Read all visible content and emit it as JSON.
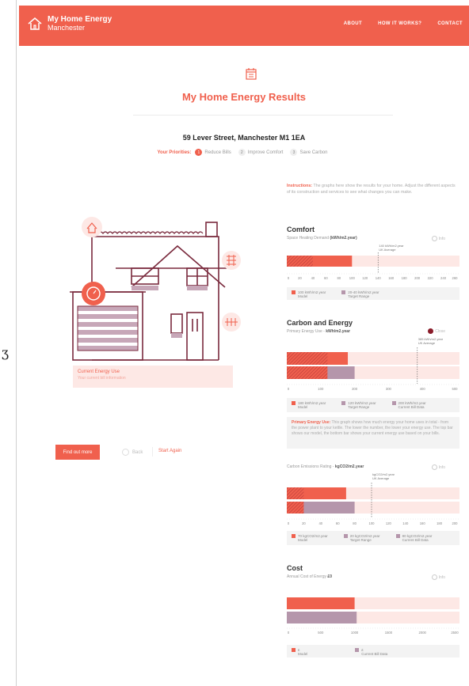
{
  "brand": {
    "line1": "My Home Energy",
    "line2": "Manchester"
  },
  "nav": [
    "ABOUT",
    "HOW IT WORKS?",
    "CONTACT"
  ],
  "page_title": "My Home Energy Results",
  "address": "59 Lever Street, Manchester M1 1EA",
  "priorities": {
    "label": "Your Priorities:",
    "steps": [
      {
        "num": "1",
        "label": "Reduce Bills"
      },
      {
        "num": "2",
        "label": "Improve Comfort"
      },
      {
        "num": "3",
        "label": "Save Carbon"
      }
    ]
  },
  "energy_card": {
    "title": "Current Energy Use",
    "subtitle": "Your current bill information"
  },
  "actions": {
    "find_out_more": "Find out more",
    "back": "Back",
    "start_again": "Start Again"
  },
  "instructions": {
    "lead": "Instructions:",
    "text": " The graphs here show the results for your home. Adjust the different aspects of its construction and services to see what changes you can make."
  },
  "colors": {
    "accent": "#f0604d",
    "model": "#f0604d",
    "target": "#b596ab",
    "dark": "#8a1c2a",
    "track": "#fde8e5"
  },
  "comfort": {
    "title": "Comfort",
    "sub_prefix": "Space Heating Demand",
    "sub_unit": "(kWh/m2.year)",
    "info": "Info",
    "avg_label_1": "140 kWh/m2.year",
    "avg_label_2": "UK Average",
    "legend": [
      {
        "value": "100 kWh/m2.year",
        "label": "Model"
      },
      {
        "value": "20-40 kWh/m2.year",
        "label": "Target Range"
      }
    ]
  },
  "carbon": {
    "title": "Carbon and Energy",
    "sub_prefix": "Primary Energy Use -",
    "sub_unit": "kWh/m2.year",
    "close": "Close",
    "avg_label_1": "385 kWh/m2.year",
    "avg_label_2": "UK Average",
    "legend": [
      {
        "value": "180 kWh/m2.year",
        "label": "Model"
      },
      {
        "value": "120 kWh/m2.year",
        "label": "Target Range"
      },
      {
        "value": "200 kWh/m2.year",
        "label": "Current Bill Data"
      }
    ],
    "desc_lead": "Primary Energy Use:",
    "desc_text": " This graph shows how much energy your home uses in total - from the power plant to your kettle. The lower the number, the lower your energy use. The top bar shows our model, the bottom bar shows your current energy use based on your bills."
  },
  "emissions": {
    "sub_prefix": "Carbon Emissions Rating -",
    "sub_unit": "kgCO2/m2.year",
    "info": "Info",
    "avg_label_1": "kgCO2/m2.year",
    "avg_label_2": "UK Average",
    "legend": [
      {
        "value": "70 kgCO2/m2.year",
        "label": "Model"
      },
      {
        "value": "20 kgCO2/m2.year",
        "label": "Target Range"
      },
      {
        "value": "80 kgCO2/m2.year",
        "label": "Current Bill Data"
      }
    ]
  },
  "cost": {
    "title": "Cost",
    "sub_prefix": "Annual Cost of Energy",
    "sub_unit": "£0",
    "info": "Info",
    "legend": [
      {
        "value": "£",
        "label": "Model"
      },
      {
        "value": "£",
        "label": "Current Bill Data"
      }
    ]
  },
  "chart_data": [
    {
      "type": "bar",
      "title": "Comfort",
      "ylabel": "Space Heating Demand (kWh/m2.year)",
      "xlim": [
        0,
        260
      ],
      "ticks": [
        0,
        20,
        40,
        60,
        80,
        100,
        120,
        140,
        160,
        180,
        200,
        220,
        240,
        260
      ],
      "reference": {
        "name": "UK Average",
        "value": 140
      },
      "series": [
        {
          "name": "Model",
          "values": [
            100
          ]
        },
        {
          "name": "Target Range",
          "range": [
            20,
            40
          ]
        }
      ]
    },
    {
      "type": "bar",
      "title": "Carbon and Energy",
      "ylabel": "Primary Energy Use - kWh/m2.year",
      "xlim": [
        0,
        500
      ],
      "ticks": [
        0,
        100,
        200,
        300,
        400,
        500
      ],
      "reference": {
        "name": "UK Average",
        "value": 385
      },
      "series": [
        {
          "name": "Model",
          "values": [
            180
          ]
        },
        {
          "name": "Target Range",
          "values": [
            120
          ]
        },
        {
          "name": "Current Bill Data",
          "values": [
            200
          ]
        }
      ]
    },
    {
      "type": "bar",
      "title": "Carbon Emissions Rating",
      "ylabel": "kgCO2/m2.year",
      "xlim": [
        0,
        200
      ],
      "ticks": [
        0,
        20,
        40,
        60,
        80,
        100,
        120,
        140,
        160,
        180,
        200
      ],
      "reference": {
        "name": "UK Average",
        "value": 100
      },
      "series": [
        {
          "name": "Model",
          "values": [
            70
          ]
        },
        {
          "name": "Target Range",
          "values": [
            20
          ]
        },
        {
          "name": "Current Bill Data",
          "values": [
            80
          ]
        }
      ]
    },
    {
      "type": "bar",
      "title": "Cost",
      "ylabel": "Annual Cost of Energy £0",
      "xlim": [
        0,
        2500
      ],
      "ticks": [
        0,
        500,
        1000,
        1500,
        2000,
        2500
      ],
      "series": [
        {
          "name": "Model",
          "values": [
            1000
          ]
        },
        {
          "name": "Current Bill Data",
          "values": [
            1030
          ]
        }
      ]
    }
  ]
}
